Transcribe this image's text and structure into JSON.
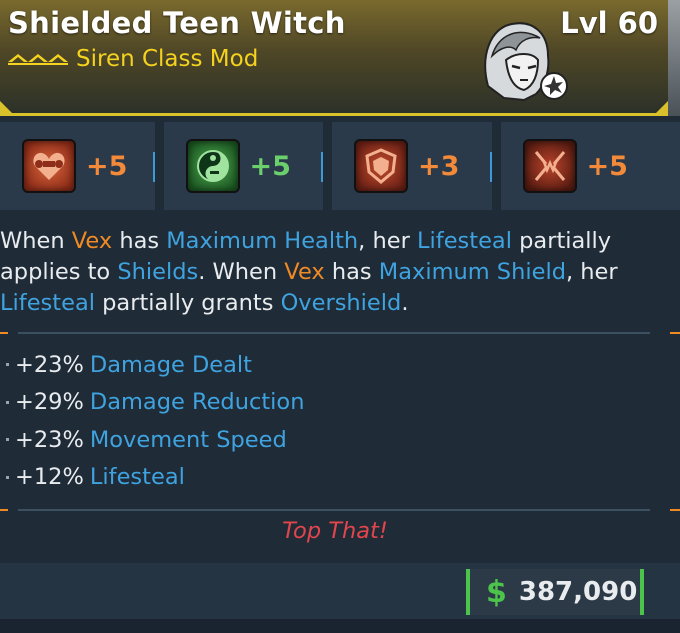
{
  "item": {
    "name": "Shielded Teen Witch",
    "level": "Lvl 60",
    "class_mod": "Siren Class Mod",
    "rarity_icon": "rarity-chevrons-icon",
    "portrait_icon": "vex-portrait-icon",
    "accent_color": "#d8c12a"
  },
  "skills": [
    {
      "icon": "muscle-heart-icon",
      "value": "+5",
      "color": "#f28a3a"
    },
    {
      "icon": "yin-yang-gun-icon",
      "value": "+5",
      "color": "#6bd06b"
    },
    {
      "icon": "shield-emblem-icon",
      "value": "+3",
      "color": "#f28a3a"
    },
    {
      "icon": "fangs-icon",
      "value": "+5",
      "color": "#f28a3a"
    }
  ],
  "description": {
    "p1": "When ",
    "vex1": "Vex",
    "p2": " has ",
    "max_health": "Maximum Health",
    "p3": ", her ",
    "lifesteal1": "Lifesteal",
    "p4": " partially applies to ",
    "shields": "Shields",
    "p5": ". When ",
    "vex2": "Vex",
    "p6": " has ",
    "max_shield": "Maximum Shield",
    "p7": ", her ",
    "lifesteal2": "Lifesteal",
    "p8": " partially grants ",
    "overshield": "Overshield",
    "p9": "."
  },
  "stats": [
    {
      "value": "+23%",
      "name": "Damage Dealt"
    },
    {
      "value": "+29%",
      "name": "Damage Reduction"
    },
    {
      "value": "+23%",
      "name": "Movement Speed"
    },
    {
      "value": "+12%",
      "name": "Lifesteal"
    }
  ],
  "flavor_text": "Top That!",
  "price": {
    "currency_symbol": "$",
    "amount": "387,090"
  }
}
